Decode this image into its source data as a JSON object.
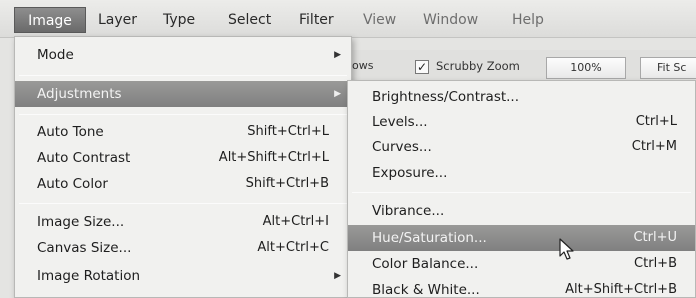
{
  "menubar": {
    "items": [
      "Image",
      "Layer",
      "Type",
      "Select",
      "Filter",
      "View",
      "Window",
      "Help"
    ]
  },
  "options_bar": {
    "partial_label": "ows",
    "scrubby_zoom": "Scrubby Zoom",
    "zoom_value": "100%",
    "fit_button": "Fit Sc"
  },
  "image_menu": {
    "mode": "Mode",
    "adjustments": "Adjustments",
    "auto_tone": {
      "label": "Auto Tone",
      "shortcut": "Shift+Ctrl+L"
    },
    "auto_contrast": {
      "label": "Auto Contrast",
      "shortcut": "Alt+Shift+Ctrl+L"
    },
    "auto_color": {
      "label": "Auto Color",
      "shortcut": "Shift+Ctrl+B"
    },
    "image_size": {
      "label": "Image Size...",
      "shortcut": "Alt+Ctrl+I"
    },
    "canvas_size": {
      "label": "Canvas Size...",
      "shortcut": "Alt+Ctrl+C"
    },
    "image_rotation": "Image Rotation"
  },
  "adjust_menu": {
    "brightness": {
      "label": "Brightness/Contrast...",
      "shortcut": ""
    },
    "levels": {
      "label": "Levels...",
      "shortcut": "Ctrl+L"
    },
    "curves": {
      "label": "Curves...",
      "shortcut": "Ctrl+M"
    },
    "exposure": {
      "label": "Exposure...",
      "shortcut": ""
    },
    "vibrance": {
      "label": "Vibrance...",
      "shortcut": ""
    },
    "hue_saturation": {
      "label": "Hue/Saturation...",
      "shortcut": "Ctrl+U"
    },
    "color_balance": {
      "label": "Color Balance...",
      "shortcut": "Ctrl+B"
    },
    "black_white": {
      "label": "Black & White...",
      "shortcut": "Alt+Shift+Ctrl+B"
    }
  },
  "colors": {
    "highlight": "#8a8a88",
    "menu_bg": "#f1f1ef"
  }
}
